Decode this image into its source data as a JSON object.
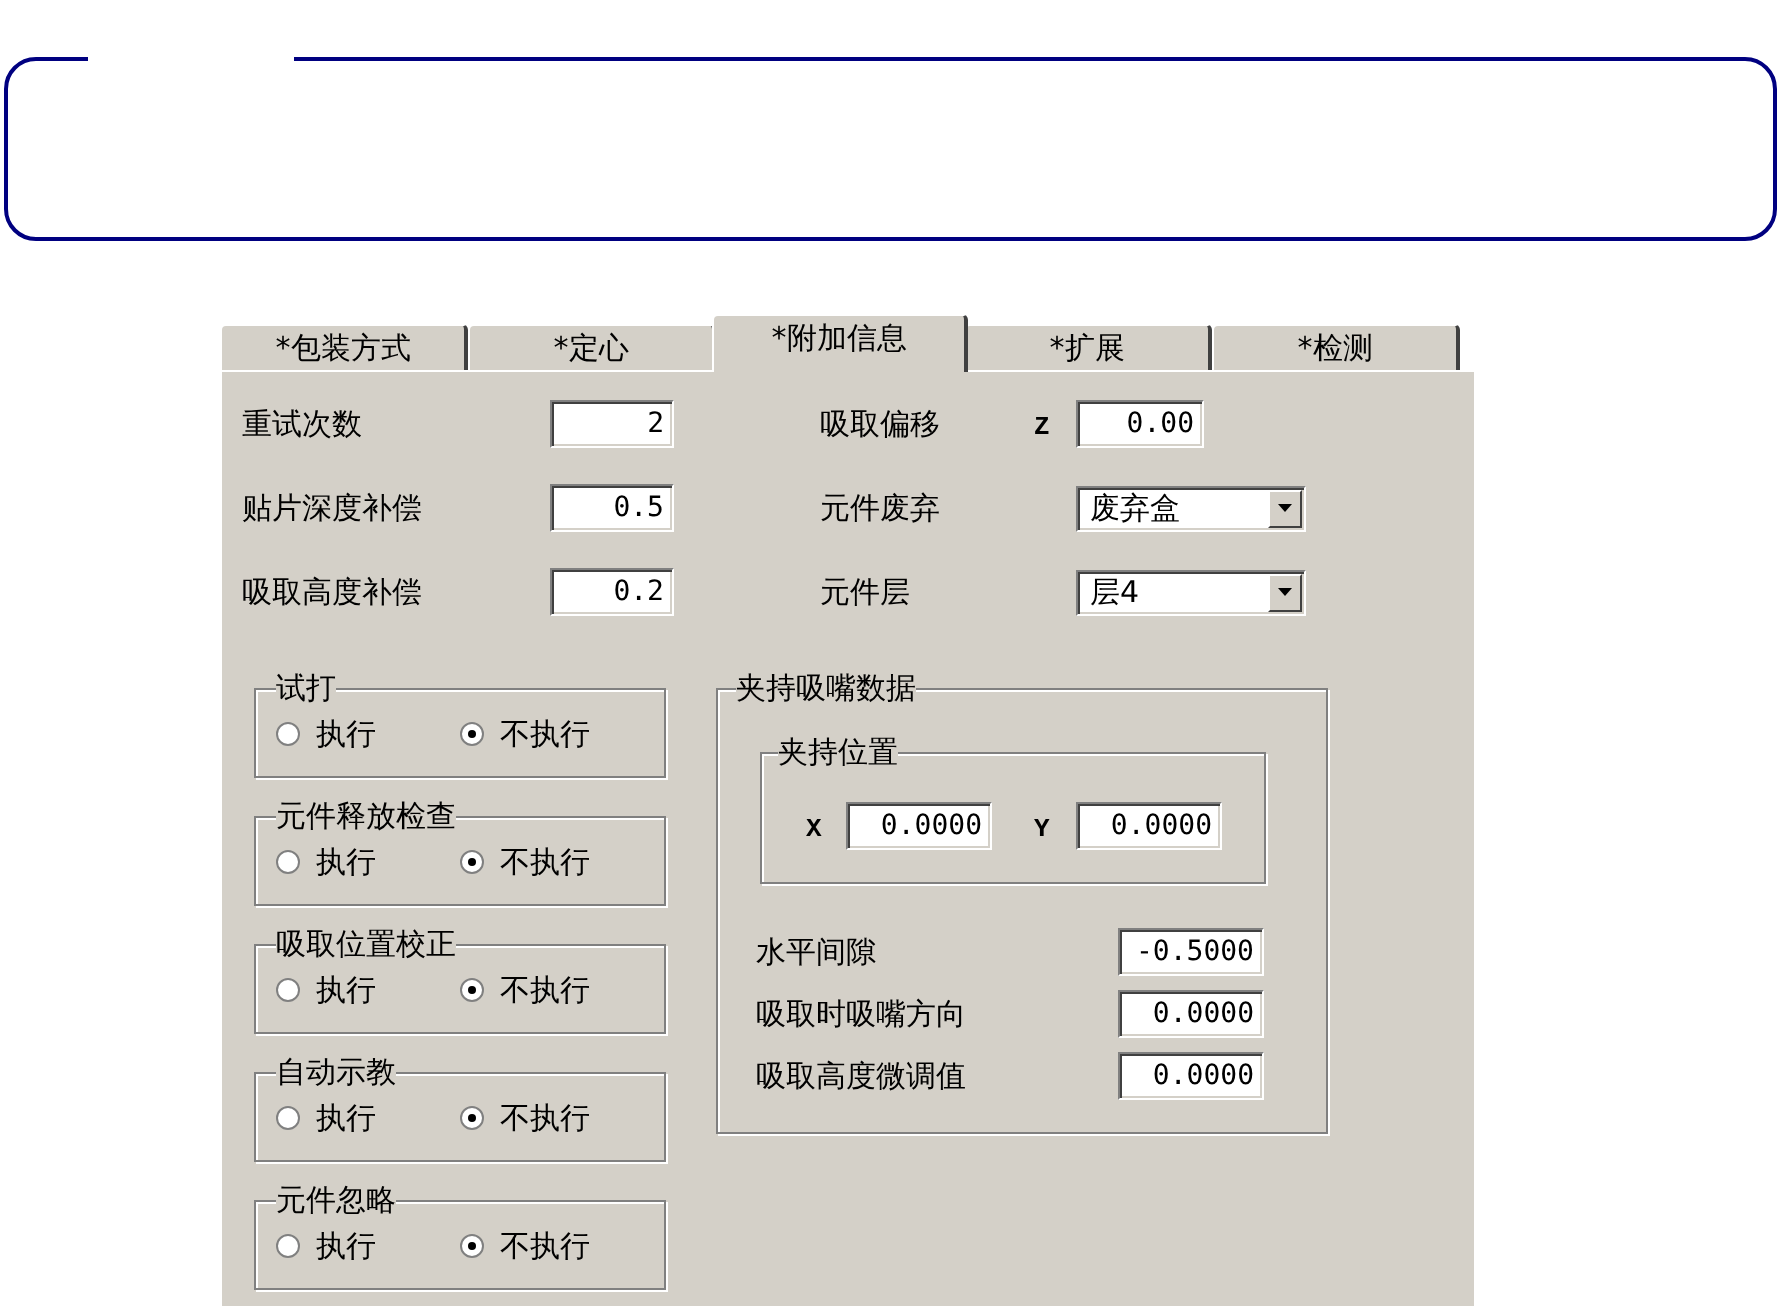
{
  "tabs": [
    {
      "label": "*包装方式",
      "selected": false
    },
    {
      "label": "*定心",
      "selected": false
    },
    {
      "label": "*附加信息",
      "selected": true
    },
    {
      "label": "*扩展",
      "selected": false
    },
    {
      "label": "*检测",
      "selected": false
    }
  ],
  "fields": [
    {
      "label": "重试次数",
      "value": "2"
    },
    {
      "label": "贴片深度补偿",
      "value": "0.5"
    },
    {
      "label": "吸取高度补偿",
      "value": "0.2"
    }
  ],
  "right_fields": [
    {
      "kind": "number",
      "label": "吸取偏移",
      "axis": "Z",
      "value": "0.00"
    },
    {
      "kind": "dropdown",
      "label": "元件废弃",
      "value": "废弃盒"
    },
    {
      "kind": "dropdown",
      "label": "元件层",
      "value": "层4"
    }
  ],
  "option_groups": [
    {
      "title": "试打",
      "options": [
        {
          "label": "执行",
          "selected": false
        },
        {
          "label": "不执行",
          "selected": true
        }
      ]
    },
    {
      "title": "元件释放检查",
      "options": [
        {
          "label": "执行",
          "selected": false
        },
        {
          "label": "不执行",
          "selected": true
        }
      ]
    },
    {
      "title": "吸取位置校正",
      "options": [
        {
          "label": "执行",
          "selected": false
        },
        {
          "label": "不执行",
          "selected": true
        }
      ]
    },
    {
      "title": "自动示教",
      "options": [
        {
          "label": "执行",
          "selected": false
        },
        {
          "label": "不执行",
          "selected": true
        }
      ]
    },
    {
      "title": "元件忽略",
      "options": [
        {
          "label": "执行",
          "selected": false
        },
        {
          "label": "不执行",
          "selected": true
        }
      ]
    }
  ],
  "nozzle_data": {
    "title": "夹持吸嘴数据",
    "position": {
      "title": "夹持位置",
      "fields": [
        {
          "label": "X",
          "value": "0.0000"
        },
        {
          "label": "Y",
          "value": "0.0000"
        }
      ]
    },
    "fields": [
      {
        "label": "水平间隙",
        "value": "-0.5000"
      },
      {
        "label": "吸取时吸嘴方向",
        "value": "0.0000"
      },
      {
        "label": "吸取高度微调值",
        "value": "0.0000"
      }
    ]
  }
}
